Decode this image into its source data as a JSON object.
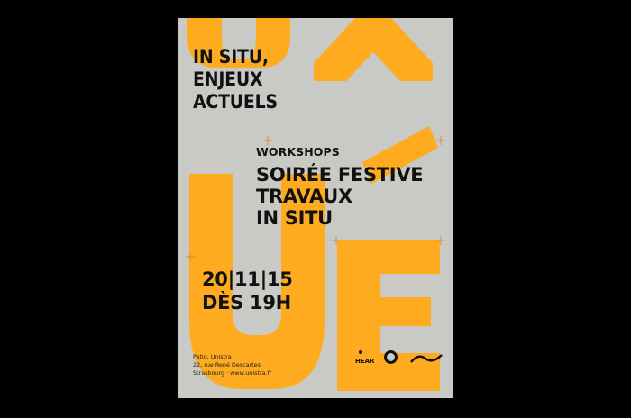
{
  "poster": {
    "title_lines": [
      "IN SITU,",
      "ENJEUX",
      "ACTUELS"
    ],
    "workshops_label": "WORKSHOPS",
    "program_lines": [
      "SOIRÉE FESTIVE",
      "TRAVAUX",
      "IN SITU"
    ],
    "date_line": "20|11|15",
    "time_line": "DÈS 19H",
    "address_lines": [
      "Patio, Unistra",
      "22, rue René Descartes",
      "Strasbourg · www.unistra.fr"
    ],
    "logo_hear": "HEAR",
    "colors": {
      "background": "#000000",
      "paper": "#c9c9c5",
      "accent_orange": "#ffab1f",
      "ink": "#111111"
    }
  }
}
